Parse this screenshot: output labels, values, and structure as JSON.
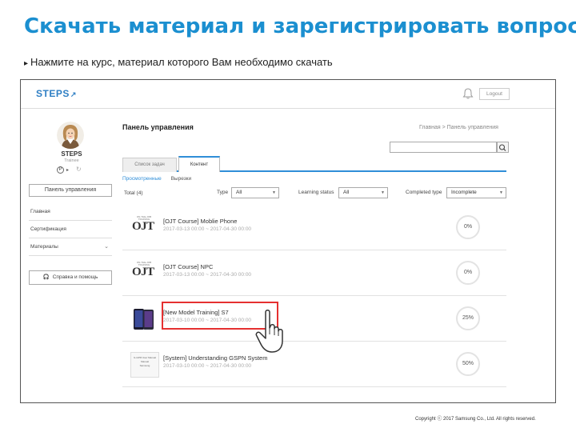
{
  "slide": {
    "title": "Скачать материал и зарегистрировать вопросы",
    "instruction_bullet": "▸",
    "instruction": "Нажмите на курс, материал которого Вам необходимо скачать",
    "copyright": "Copyright ⓒ 2017 Samsung Co., Ltd. All rights reserved."
  },
  "app": {
    "logo": "STEPS",
    "logo_mark": "↗",
    "logout": "Logout"
  },
  "profile": {
    "name": "STEPS",
    "role": "Trainee",
    "points_icon": "P",
    "arrow": "▸",
    "refresh": "↻"
  },
  "sidebar": {
    "dashboard_button": "Панель управления",
    "items": [
      {
        "label": "Главная"
      },
      {
        "label": "Сертификация"
      },
      {
        "label": "Материалы",
        "chevron": "⌄"
      }
    ],
    "help_icon": "🎧",
    "help_button": "Справка и помощь"
  },
  "main": {
    "title": "Панель управления",
    "breadcrumb": "Главная > Панель управления",
    "tabs": [
      {
        "label": "Список задач"
      },
      {
        "label": "Контент"
      }
    ],
    "subtabs": [
      {
        "label": "Просмотренные"
      },
      {
        "label": "Вырезки"
      }
    ],
    "filters": {
      "total": "Total (4)",
      "type_label": "Type",
      "type_value": "All",
      "learning_label": "Learning status",
      "learning_value": "All",
      "completed_label": "Completed type",
      "completed_value": "Incomplete",
      "dropdown_glyph": "▼"
    },
    "thumbs": {
      "ojt": "OJT",
      "ojt_top": "ON-THE-JOB TRAINING",
      "doc_lines": [
        "G-GPM User Manual",
        "Manual",
        "Samsung"
      ]
    },
    "courses": [
      {
        "title": "[OJT Course] Moblie Phone",
        "dates": "2017-03-13 00:00 ~ 2017-04-30 00:00",
        "progress": "0%",
        "thumb": "ojt"
      },
      {
        "title": "[OJT Course] NPC",
        "dates": "2017-03-13 00:00 ~ 2017-04-30 00:00",
        "progress": "0%",
        "thumb": "ojt"
      },
      {
        "title": "[New Model Training] S7",
        "dates": "2017-03-10 00:00 ~ 2017-04-30 00:00",
        "progress": "25%",
        "thumb": "phone"
      },
      {
        "title": "[System] Understanding GSPN System",
        "dates": "2017-03-10 00:00 ~ 2017-04-30 00:00",
        "progress": "50%",
        "thumb": "doc"
      }
    ]
  },
  "colors": {
    "title_blue": "#1b8fd0",
    "accent_blue": "#2f8ed8",
    "highlight_red": "#e53030"
  }
}
